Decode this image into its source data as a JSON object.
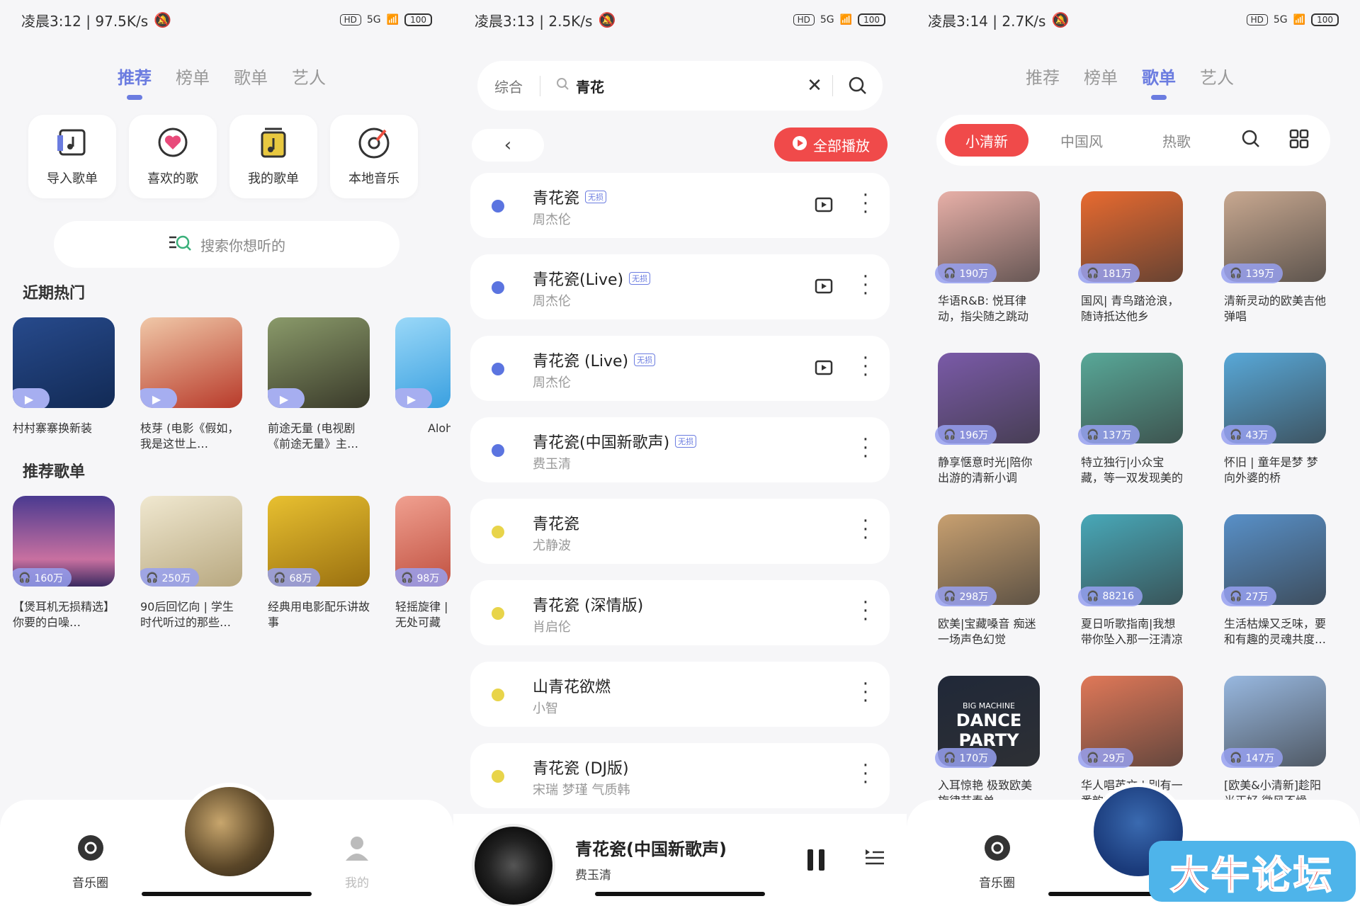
{
  "status": {
    "s1": {
      "time": "凌晨3:12 | 97.5K/s"
    },
    "s2": {
      "time": "凌晨3:13 | 2.5K/s"
    },
    "s3": {
      "time": "凌晨3:14 | 2.7K/s"
    },
    "hd": "HD",
    "net": "5G",
    "battery": "100"
  },
  "tabs": [
    "推荐",
    "榜单",
    "歌单",
    "艺人"
  ],
  "s1": {
    "shortcuts": [
      {
        "label": "导入歌单",
        "icon": "import-playlist-icon"
      },
      {
        "label": "喜欢的歌",
        "icon": "heart-icon"
      },
      {
        "label": "我的歌单",
        "icon": "my-playlist-icon"
      },
      {
        "label": "本地音乐",
        "icon": "local-music-icon"
      }
    ],
    "search_placeholder": "搜索你想听的",
    "recent_title": "近期热门",
    "recent": [
      {
        "caption": "村村寨寨换新装",
        "color": "#2a4f8a"
      },
      {
        "caption": "枝芽 (电影《假如，我是这世上…",
        "color": "#c94a3a"
      },
      {
        "caption": "前途无量 (电视剧《前途无量》主…",
        "color": "#5a6a3a"
      },
      {
        "caption": "Aloh",
        "color": "#5ab4e8"
      }
    ],
    "playlist_title": "推荐歌单",
    "playlists": [
      {
        "caption": "【煲耳机无损精选】你要的白噪…",
        "count": "160万",
        "color": "#6a5ab0"
      },
      {
        "caption": "90后回忆向 | 学生时代听过的那些…",
        "count": "250万",
        "color": "#d8c8a8"
      },
      {
        "caption": "经典用电影配乐讲故事",
        "count": "68万",
        "color": "#c8a020"
      },
      {
        "caption": "轻摇旋律 | 无处可藏",
        "count": "98万",
        "color": "#d86050"
      }
    ],
    "nav": {
      "left": "音乐圈",
      "right": "我的"
    }
  },
  "s2": {
    "scope": "综合",
    "query": "青花",
    "play_all": "全部播放",
    "lossless": "无损",
    "songs": [
      {
        "title": "青花瓷",
        "artist": "周杰伦",
        "lossless": true,
        "mv": true,
        "dot": "#5b74e0"
      },
      {
        "title": "青花瓷(Live)",
        "artist": "周杰伦",
        "lossless": true,
        "mv": true,
        "dot": "#5b74e0"
      },
      {
        "title": "青花瓷 (Live)",
        "artist": "周杰伦",
        "lossless": true,
        "mv": true,
        "dot": "#5b74e0"
      },
      {
        "title": "青花瓷(中国新歌声)",
        "artist": "费玉清",
        "lossless": true,
        "mv": false,
        "dot": "#5b74e0"
      },
      {
        "title": "青花瓷",
        "artist": "尤静波",
        "lossless": false,
        "mv": false,
        "dot": "#e8d44a"
      },
      {
        "title": "青花瓷 (深情版)",
        "artist": "肖启伦",
        "lossless": false,
        "mv": false,
        "dot": "#e8d44a"
      },
      {
        "title": "山青花欲燃",
        "artist": "小智",
        "lossless": false,
        "mv": false,
        "dot": "#e8d44a"
      },
      {
        "title": "青花瓷 (DJ版)",
        "artist": "宋瑞 梦瑾 气质韩",
        "lossless": false,
        "mv": false,
        "dot": "#e8d44a"
      }
    ],
    "now_playing": {
      "title": "青花瓷(中国新歌声)",
      "artist": "费玉清"
    }
  },
  "s3": {
    "chips": [
      "小清新",
      "中国风",
      "热歌"
    ],
    "playlists": [
      {
        "caption": "华语R&B: 悦耳律动，指尖随之跳动",
        "count": "190万",
        "color": "#e8b0a8"
      },
      {
        "caption": "国风| 青鸟踏沧浪，随诗抵达他乡",
        "count": "181万",
        "color": "#e86a30"
      },
      {
        "caption": "清新灵动的欧美吉他弹唱",
        "count": "139万",
        "color": "#c8a890"
      },
      {
        "caption": "静享惬意时光|陪你出游的清新小调",
        "count": "196万",
        "color": "#7a5aa8"
      },
      {
        "caption": "特立独行|小众宝藏，等一双发现美的耳朵",
        "count": "137万",
        "color": "#58a898"
      },
      {
        "caption": "怀旧 | 童年是梦 梦向外婆的桥",
        "count": "43万",
        "color": "#58a8d8"
      },
      {
        "caption": "欧美|宝藏嗓音 痴迷一场声色幻觉",
        "count": "298万",
        "color": "#c8a070"
      },
      {
        "caption": "夏日听歌指南|我想带你坠入那一汪清凉",
        "count": "88216",
        "color": "#48a8b8"
      },
      {
        "caption": "生活枯燥又乏味，要和有趣的灵魂共度…",
        "count": "27万",
        "color": "#5890c8"
      },
      {
        "caption": "入耳惊艳 极致欧美旋律节奏单",
        "count": "170万",
        "color": "#202838"
      },
      {
        "caption": "华人唱英文 | 别有一番韵味在心中",
        "count": "29万",
        "color": "#e07858"
      },
      {
        "caption": "[欧美&小清新]趁阳光正好 微风不燥",
        "count": "147万",
        "color": "#98b8e0"
      }
    ],
    "dance_text": "DANCE PARTY",
    "dance_sub": "BIG MACHINE",
    "nav": {
      "left": "音乐圈"
    }
  },
  "watermark": "大牛论坛"
}
